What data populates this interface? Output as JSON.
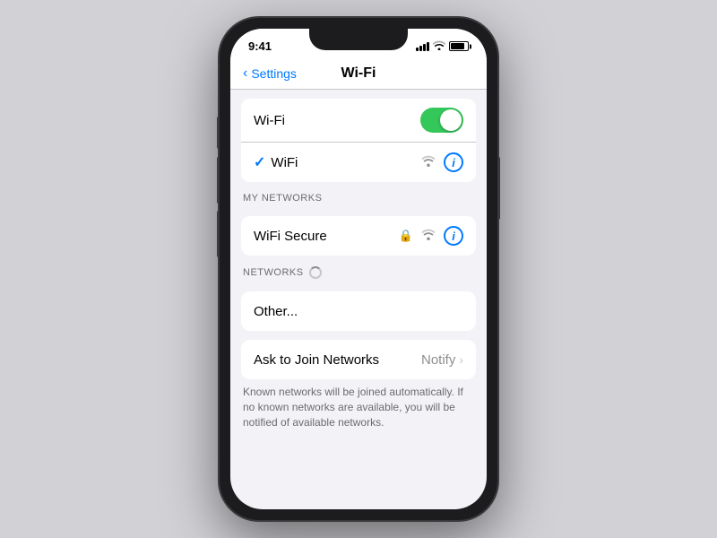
{
  "status": {
    "time": "9:41",
    "signal_bars": [
      3,
      5,
      7,
      10,
      12
    ],
    "battery_level": 85
  },
  "navigation": {
    "back_label": "Settings",
    "title": "Wi-Fi"
  },
  "wifi_section": {
    "wifi_toggle_label": "Wi-Fi",
    "wifi_toggle_state": true,
    "connected_network": "WiFi",
    "connected_checkmark": "✓"
  },
  "my_networks": {
    "header": "MY NETWORKS",
    "network_name": "WiFi Secure"
  },
  "networks": {
    "header": "NETWORKS",
    "other_label": "Other..."
  },
  "ask_to_join": {
    "label": "Ask to Join Networks",
    "value": "Notify",
    "footer": "Known networks will be joined automatically. If no known networks are available, you will be notified of available networks."
  }
}
